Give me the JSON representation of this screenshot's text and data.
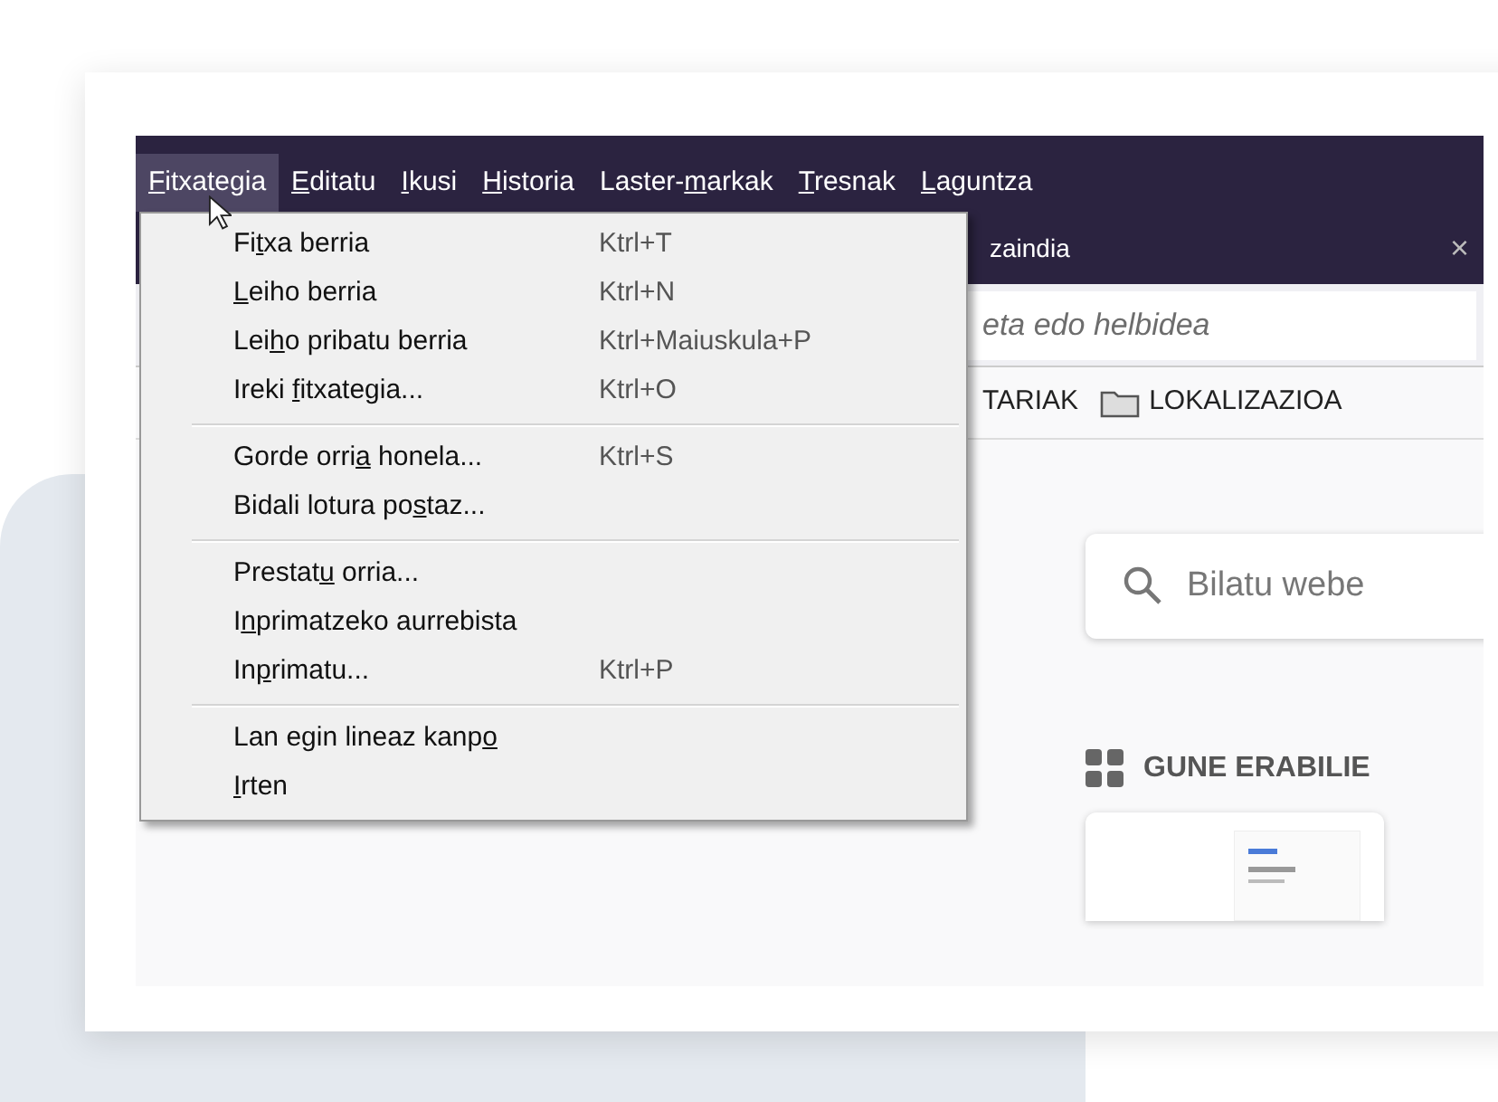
{
  "menubar": [
    {
      "label_parts": {
        "key": "F",
        "after": "itxategia"
      },
      "selected": true
    },
    {
      "label_parts": {
        "key": "E",
        "after": "ditatu"
      },
      "selected": false
    },
    {
      "label_parts": {
        "key": "I",
        "after": "kusi"
      },
      "selected": false
    },
    {
      "label_parts": {
        "key": "H",
        "after": "istoria"
      },
      "selected": false
    },
    {
      "label_parts": {
        "before": "Laster-",
        "key": "m",
        "after": "arkak"
      },
      "selected": false
    },
    {
      "label_parts": {
        "key": "T",
        "after": "resnak"
      },
      "selected": false
    },
    {
      "label_parts": {
        "key": "L",
        "after": "aguntza"
      },
      "selected": false
    }
  ],
  "tab": {
    "title": "zaindia",
    "close": "×"
  },
  "address_bar": {
    "placeholder": "eta edo helbidea"
  },
  "bookmarks": [
    {
      "label": "TARIAK",
      "kind": "text"
    },
    {
      "label": "LOKALIZAZIOA",
      "kind": "folder"
    }
  ],
  "search": {
    "placeholder": "Bilatu webe"
  },
  "top_sites": {
    "heading": "GUNE ERABILIE"
  },
  "menu": [
    {
      "kind": "item",
      "label_parts": {
        "before": "Fi",
        "key": "t",
        "after": "xa berria"
      },
      "shortcut": "Ktrl+T"
    },
    {
      "kind": "item",
      "label_parts": {
        "key": "L",
        "after": "eiho berria"
      },
      "shortcut": "Ktrl+N"
    },
    {
      "kind": "item",
      "label_parts": {
        "before": "Lei",
        "key": "h",
        "after": "o pribatu berria"
      },
      "shortcut": "Ktrl+Maiuskula+P"
    },
    {
      "kind": "item",
      "label_parts": {
        "before": "Ireki ",
        "key": "f",
        "after": "itxategia..."
      },
      "shortcut": "Ktrl+O"
    },
    {
      "kind": "separator"
    },
    {
      "kind": "item",
      "label_parts": {
        "before": "Gorde orri",
        "key": "a",
        "after": " honela..."
      },
      "shortcut": "Ktrl+S"
    },
    {
      "kind": "item",
      "label_parts": {
        "before": "Bidali lotura po",
        "key": "s",
        "after": "taz..."
      }
    },
    {
      "kind": "separator"
    },
    {
      "kind": "item",
      "label_parts": {
        "before": "Prestat",
        "key": "u",
        "after": " orria..."
      }
    },
    {
      "kind": "item",
      "label_parts": {
        "before": "I",
        "key": "n",
        "after": "primatzeko aurrebista"
      }
    },
    {
      "kind": "item",
      "label_parts": {
        "before": "In",
        "key": "p",
        "after": "rimatu..."
      },
      "shortcut": "Ktrl+P"
    },
    {
      "kind": "separator"
    },
    {
      "kind": "item",
      "label_parts": {
        "before": "Lan egin lineaz kanp",
        "key": "o"
      }
    },
    {
      "kind": "item",
      "label_parts": {
        "key": "I",
        "after": "rten"
      }
    }
  ]
}
